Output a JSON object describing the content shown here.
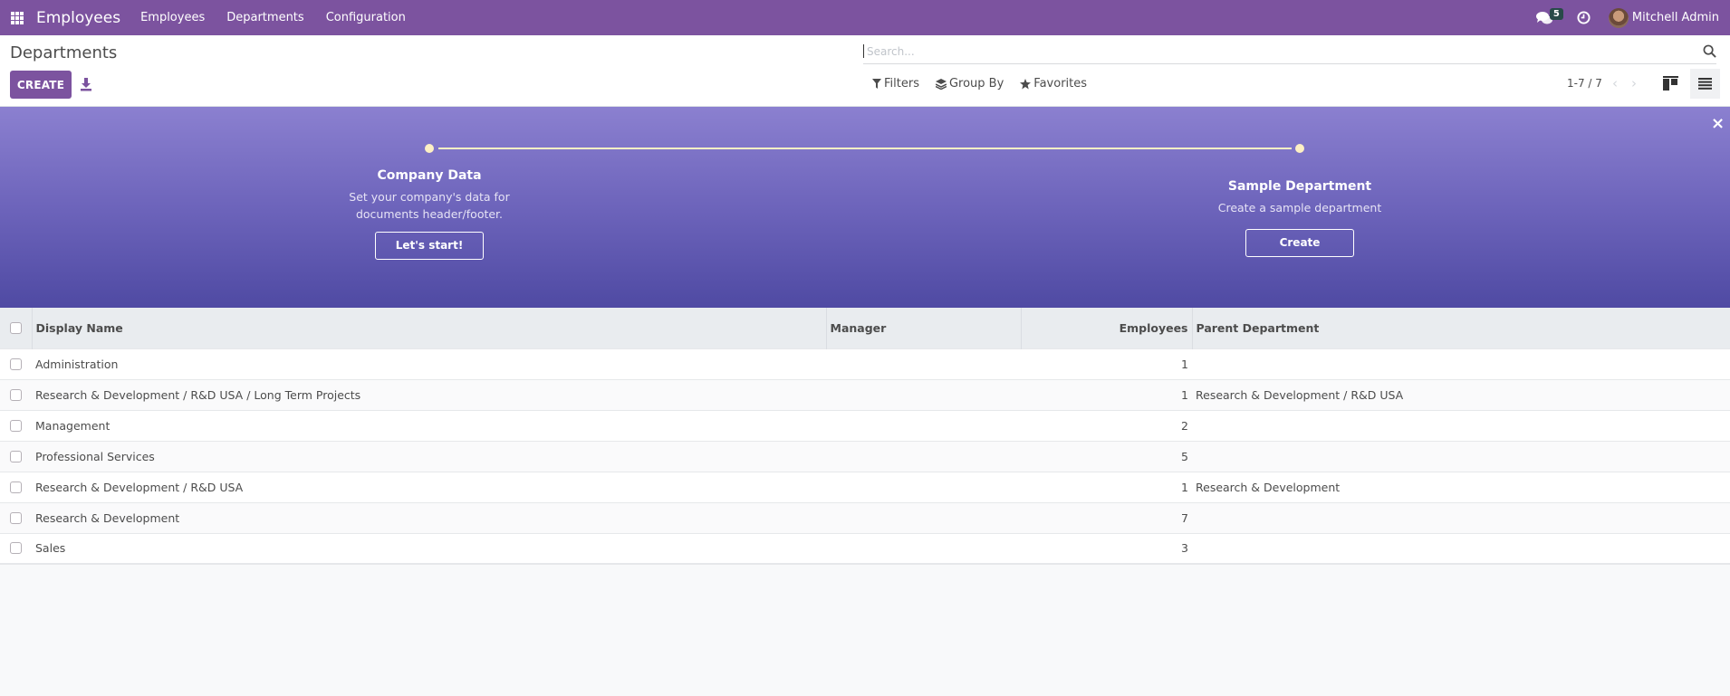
{
  "navbar": {
    "app_name": "Employees",
    "menu": [
      "Employees",
      "Departments",
      "Configuration"
    ],
    "messages_count": "5",
    "user_name": "Mitchell Admin"
  },
  "control_panel": {
    "title": "Departments",
    "create_label": "CREATE",
    "search_placeholder": "Search...",
    "filters_label": "Filters",
    "groupby_label": "Group By",
    "favorites_label": "Favorites",
    "pager": "1-7 / 7"
  },
  "banner": {
    "steps": [
      {
        "title": "Company Data",
        "description": "Set your company's data for documents header/footer.",
        "button": "Let's start!"
      },
      {
        "title": "Sample Department",
        "description": "Create a sample department",
        "button": "Create"
      }
    ],
    "close_glyph": "×"
  },
  "table": {
    "columns": [
      "Display Name",
      "Manager",
      "Employees",
      "Parent Department"
    ],
    "rows": [
      {
        "name": "Administration",
        "manager": "",
        "employees": "1",
        "parent": ""
      },
      {
        "name": "Research & Development / R&D USA / Long Term Projects",
        "manager": "",
        "employees": "1",
        "parent": "Research & Development / R&D USA"
      },
      {
        "name": "Management",
        "manager": "",
        "employees": "2",
        "parent": ""
      },
      {
        "name": "Professional Services",
        "manager": "",
        "employees": "5",
        "parent": ""
      },
      {
        "name": "Research & Development / R&D USA",
        "manager": "",
        "employees": "1",
        "parent": "Research & Development"
      },
      {
        "name": "Research & Development",
        "manager": "",
        "employees": "7",
        "parent": ""
      },
      {
        "name": "Sales",
        "manager": "",
        "employees": "3",
        "parent": ""
      }
    ]
  },
  "colors": {
    "brand": "#7c539f",
    "banner_top": "#8b80d0",
    "banner_bottom": "#4f4aa3",
    "progress": "#fdf0c4"
  }
}
